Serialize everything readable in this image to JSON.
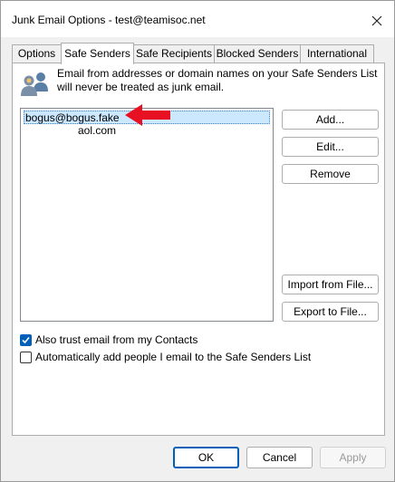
{
  "window": {
    "title": "Junk Email Options - test@teamisoc.net"
  },
  "tabs": [
    {
      "label": "Options",
      "active": false
    },
    {
      "label": "Safe Senders",
      "active": true
    },
    {
      "label": "Safe Recipients",
      "active": false
    },
    {
      "label": "Blocked Senders",
      "active": false
    },
    {
      "label": "International",
      "active": false
    }
  ],
  "safe_senders": {
    "description": "Email from addresses or domain names on your Safe Senders List will never be treated as junk email.",
    "list": [
      "bogus@bogus.fake",
      "aol.com"
    ],
    "selected_index": 0,
    "buttons": {
      "add": "Add...",
      "edit": "Edit...",
      "remove": "Remove",
      "import": "Import from File...",
      "export": "Export to File..."
    },
    "checkboxes": [
      {
        "label": "Also trust email from my Contacts",
        "checked": true
      },
      {
        "label": "Automatically add people I email to the Safe Senders List",
        "checked": false
      }
    ]
  },
  "footer": {
    "ok": "OK",
    "cancel": "Cancel",
    "apply": "Apply"
  },
  "annotation": {
    "arrow_color": "#e81123"
  },
  "colors": {
    "accent": "#005fb8",
    "selection": "#cce8ff"
  }
}
